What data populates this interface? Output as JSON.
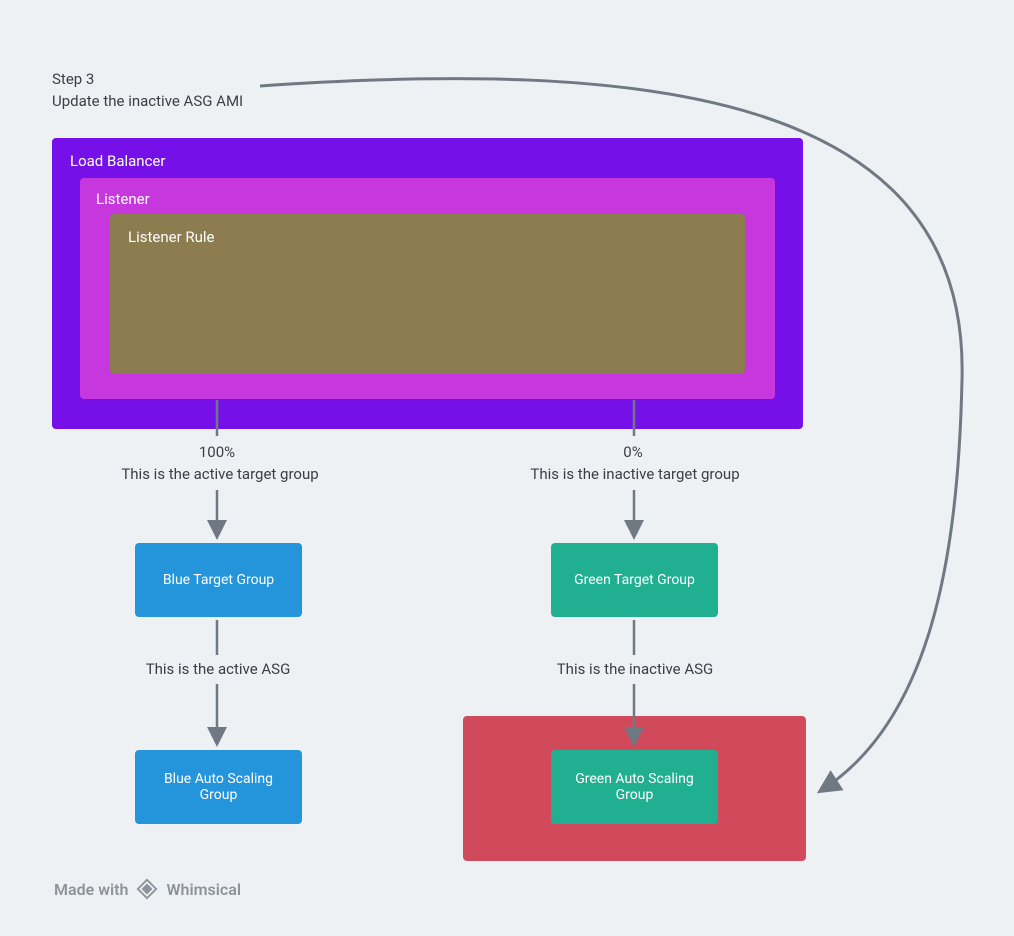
{
  "step": {
    "line1": "Step 3",
    "line2": "Update the inactive ASG AMI"
  },
  "boxes": {
    "load_balancer": "Load Balancer",
    "listener": "Listener",
    "listener_rule": "Listener Rule"
  },
  "blue": {
    "pct": "100%",
    "pct_note": "This is the active target group",
    "target_group": "Blue Target Group",
    "asg_note": "This is the active ASG",
    "asg": "Blue Auto Scaling Group"
  },
  "green": {
    "pct": "0%",
    "pct_note": "This is the inactive target group",
    "target_group": "Green Target Group",
    "asg_note": "This is the inactive ASG",
    "asg": "Green Auto Scaling Group"
  },
  "footer": {
    "made_with": "Made with",
    "brand": "Whimsical"
  }
}
